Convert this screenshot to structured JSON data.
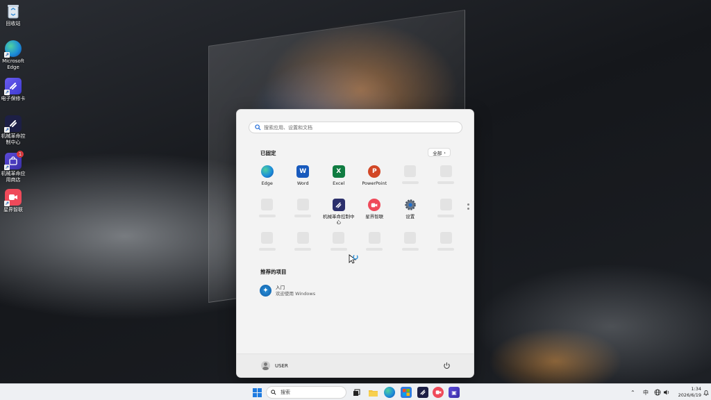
{
  "desktop": {
    "icons": [
      {
        "label": "回收站",
        "icon": "recycle-bin-icon"
      },
      {
        "label": "Microsoft Edge",
        "icon": "edge-icon"
      },
      {
        "label": "电子保修卡",
        "icon": "warranty-card-icon"
      },
      {
        "label": "机械革命控制中心",
        "icon": "mechrevo-control-center-icon"
      },
      {
        "label": "机械革命应用商店",
        "icon": "mechrevo-store-icon",
        "badge": "1"
      },
      {
        "label": "星界智联",
        "icon": "xingjie-zhilian-icon"
      }
    ]
  },
  "start_menu": {
    "search_placeholder": "搜索应用、设置和文档",
    "pinned_title": "已固定",
    "all_button": "全部",
    "pinned_apps": [
      {
        "label": "Edge",
        "icon": "edge-icon",
        "color": "#1d8fd8"
      },
      {
        "label": "Word",
        "icon": "word-icon",
        "color": "#185abd"
      },
      {
        "label": "Excel",
        "icon": "excel-icon",
        "color": "#107c41"
      },
      {
        "label": "PowerPoint",
        "icon": "powerpoint-icon",
        "color": "#d24726"
      },
      {
        "label": "机械革命控制中心",
        "icon": "mechrevo-control-center-icon",
        "color": "#2b2f6b"
      },
      {
        "label": "星界智联",
        "icon": "xingjie-zhilian-icon",
        "color": "#ef4a5a"
      },
      {
        "label": "设置",
        "icon": "settings-gear-icon",
        "color": "#5f6b7a"
      }
    ],
    "recommended_title": "推荐的项目",
    "recommended": [
      {
        "title": "入门",
        "subtitle": "欢迎使用 Windows",
        "icon": "get-started-icon"
      }
    ],
    "user_name": "USER"
  },
  "taskbar": {
    "search_label": "搜索",
    "ime": "中",
    "time": "1:34",
    "date": "2026/6/19"
  }
}
